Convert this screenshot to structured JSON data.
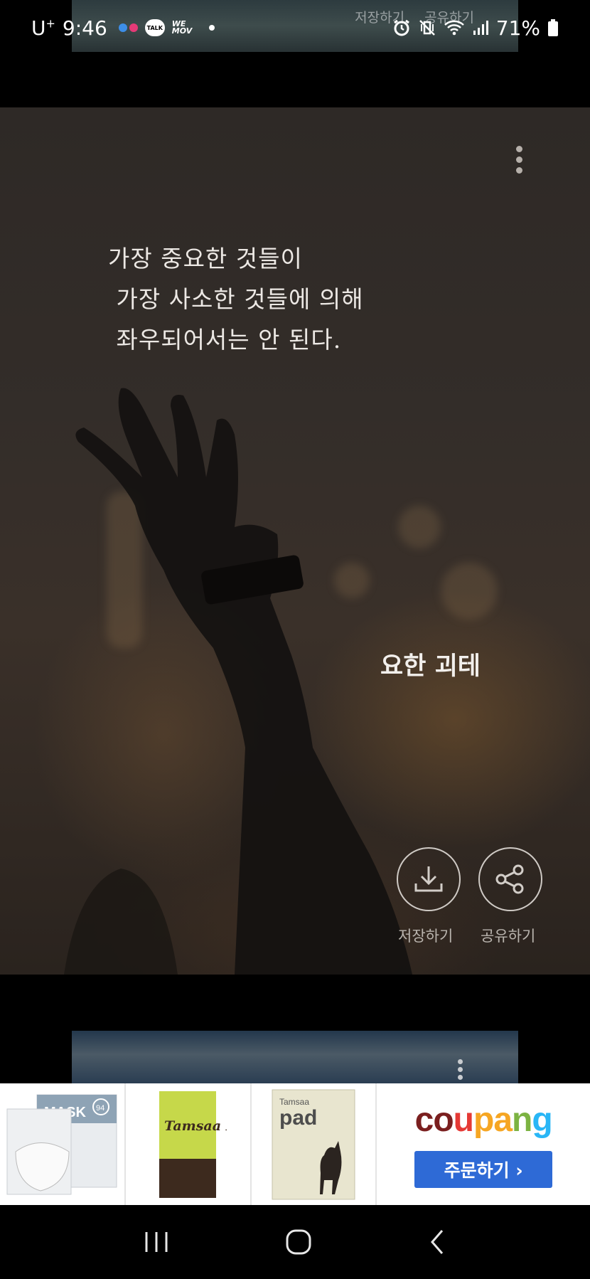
{
  "status_bar": {
    "carrier": "U",
    "carrier_sup": "+",
    "time": "9:46",
    "talk_icon_text": "TALK",
    "wemov_line1": "WE",
    "wemov_line2": "MOV",
    "battery_percent": "71%"
  },
  "prev_card": {
    "save_label": "저장하기",
    "share_label": "공유하기"
  },
  "quote_card": {
    "lines": [
      "가장 중요한 것들이",
      " 가장 사소한 것들에 의해",
      " 좌우되어서는 안 된다."
    ],
    "author": "요한 괴테",
    "save_label": "저장하기",
    "share_label": "공유하기"
  },
  "ad": {
    "products": [
      "mask-product",
      "tissue-product",
      "pet-pad-product"
    ],
    "mask_text": "MASK",
    "mask_grade": "94",
    "tissue_text": "Tamsaa Pure",
    "pad_brand": "Tamsaa",
    "pad_text": "pad",
    "brand_logo": "coupang",
    "brand_colors": [
      "#7a1f1f",
      "#e53935",
      "#f6a623",
      "#7cb342",
      "#29b6f6"
    ],
    "order_button": "주문하기 ›",
    "accent": "#2e6ad6"
  },
  "nav_bar": {
    "icons": [
      "recent-apps-icon",
      "home-icon",
      "back-icon"
    ]
  }
}
